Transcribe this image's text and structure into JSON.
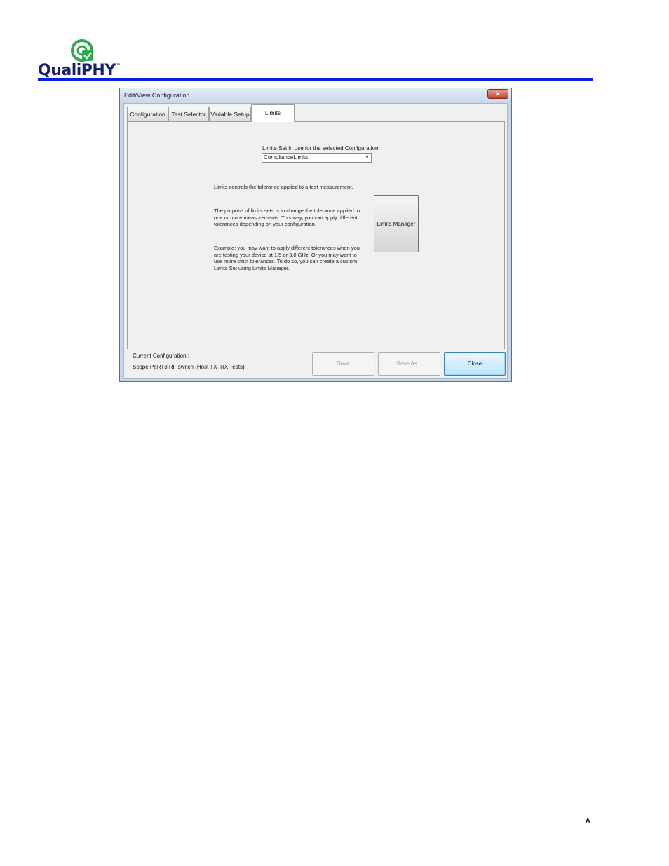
{
  "brand": {
    "name": "QualiPHY",
    "trademark": "™",
    "colors": {
      "logo_green": "#2ea84a",
      "logo_text": "#1b1f6b",
      "rule": "#0a1fd8"
    }
  },
  "dialog": {
    "title": "Edit/View Configuration",
    "close_icon": "×",
    "tabs": [
      {
        "label": "Configuration",
        "active": false
      },
      {
        "label": "Test Selector",
        "active": false
      },
      {
        "label": "Variable Setup",
        "active": false
      },
      {
        "label": "Limits",
        "active": true
      }
    ],
    "limits": {
      "label": "Limits Set in use for the selected Configuration",
      "selected": "ComplianceLimits",
      "paragraphs": [
        "Limits controls the tolerance applied to a test measurement.",
        "The purpose of limits sets is to change the tolerance applied to one or more measurements. This way, you can apply different tolerances depending on your configuration.",
        "Example: you may want to apply different tolerances when you are testing your device at 1.5 or 3.0 GHz. Or you may want to use more strict tolerances. To do so, you can create a custom Limits Set using Limits Manager."
      ],
      "manager_button": "Limits Manager"
    },
    "footer": {
      "current_label": "Current Configuration :",
      "current_value": "Scope PeRT3 RF switch (Host TX_RX Tests)",
      "save": "Save",
      "save_as": "Save As...",
      "close": "Close"
    }
  },
  "page_footer": {
    "letter": "A"
  }
}
